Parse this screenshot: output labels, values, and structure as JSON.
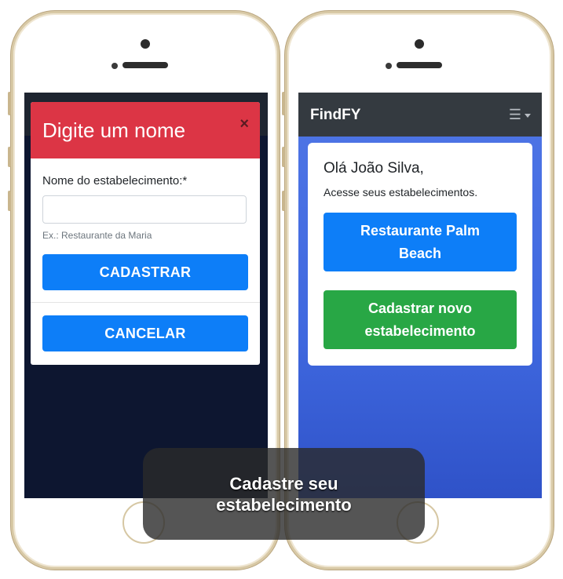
{
  "left_phone": {
    "modal": {
      "title": "Digite um nome",
      "close_icon": "×",
      "field_label": "Nome do estabelecimento:*",
      "field_value": "",
      "field_help": "Ex.: Restaurante da Maria",
      "submit_label": "CADASTRAR",
      "cancel_label": "CANCELAR"
    }
  },
  "right_phone": {
    "navbar": {
      "brand": "FindFY",
      "menu_icon": "☰"
    },
    "card": {
      "greeting": "Olá João Silva,",
      "subtitle": "Acesse seus estabelecimentos.",
      "establishment_button": "Restaurante Palm Beach",
      "new_establishment_button": "Cadastrar novo estabelecimento"
    }
  },
  "caption": {
    "text": "Cadastre seu estabelecimento"
  },
  "colors": {
    "modal_header": "#dc3545",
    "primary": "#0d7ef8",
    "success": "#28a745",
    "navbar": "#343a40",
    "screen_bg": "#4f76e6"
  }
}
